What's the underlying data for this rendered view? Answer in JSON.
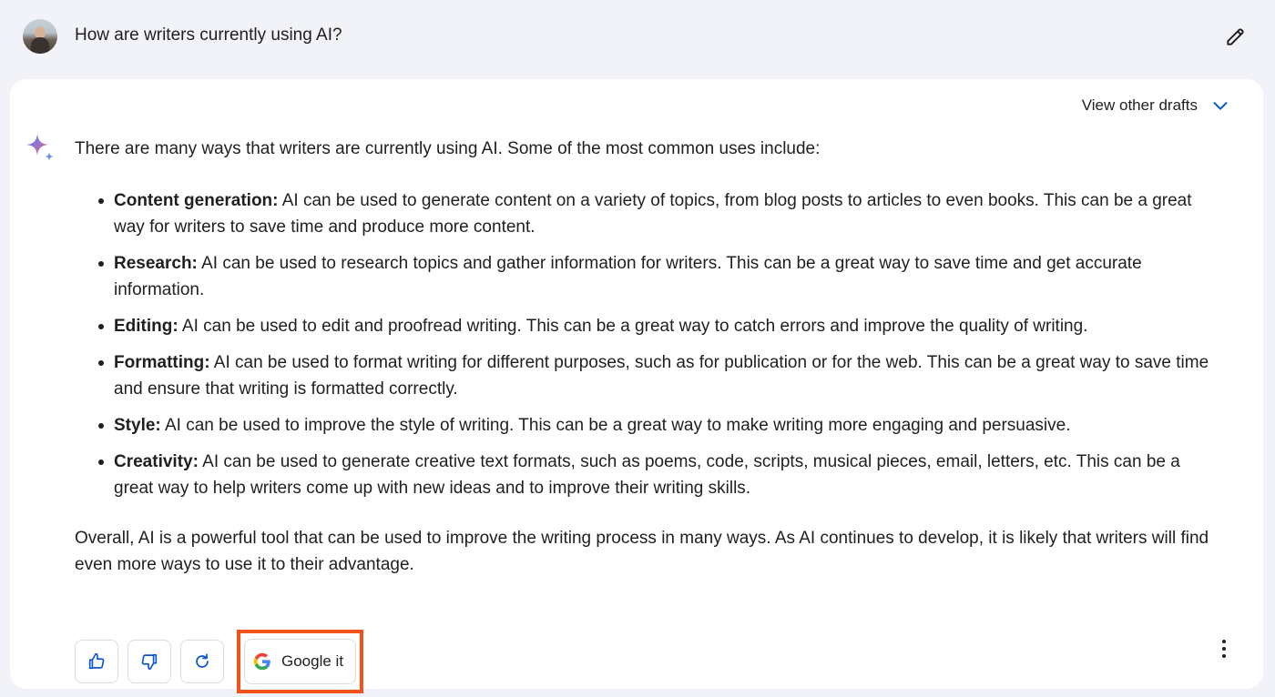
{
  "prompt": {
    "text": "How are writers currently using AI?",
    "avatar_icon": "user-avatar",
    "edit_icon": "pencil-icon"
  },
  "response": {
    "view_drafts_label": "View other drafts",
    "intro": "There are many ways that writers are currently using AI. Some of the most common uses include:",
    "items": [
      {
        "term": "Content generation:",
        "text": " AI can be used to generate content on a variety of topics, from blog posts to articles to even books. This can be a great way for writers to save time and produce more content."
      },
      {
        "term": "Research:",
        "text": " AI can be used to research topics and gather information for writers. This can be a great way to save time and get accurate information."
      },
      {
        "term": "Editing:",
        "text": " AI can be used to edit and proofread writing. This can be a great way to catch errors and improve the quality of writing."
      },
      {
        "term": "Formatting:",
        "text": " AI can be used to format writing for different purposes, such as for publication or for the web. This can be a great way to save time and ensure that writing is formatted correctly."
      },
      {
        "term": "Style:",
        "text": " AI can be used to improve the style of writing. This can be a great way to make writing more engaging and persuasive."
      },
      {
        "term": "Creativity:",
        "text": " AI can be used to generate creative text formats, such as poems, code, scripts, musical pieces, email, letters, etc. This can be a great way to help writers come up with new ideas and to improve their writing skills."
      }
    ],
    "outro": "Overall, AI is a powerful tool that can be used to improve the writing process in many ways. As AI continues to develop, it is likely that writers will find even more ways to use it to their advantage."
  },
  "actions": {
    "google_label": "Google it",
    "icons": [
      "thumbs-up-icon",
      "thumbs-down-icon",
      "regenerate-icon",
      "google-logo-icon",
      "more-vert-icon"
    ],
    "highlight_color": "#f2531b",
    "accent_color": "#0b57d0"
  }
}
